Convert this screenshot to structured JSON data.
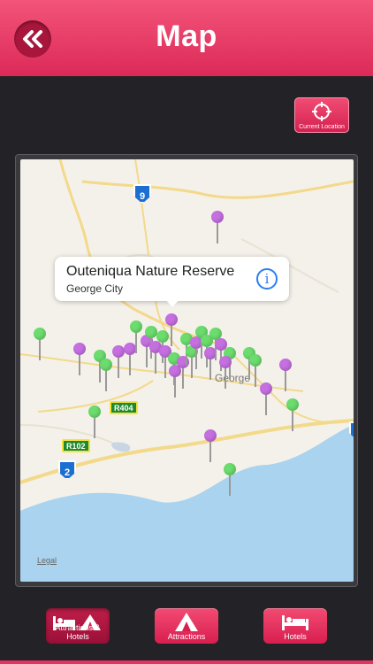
{
  "header": {
    "title": "Map",
    "back_icon": "double-chevron-left-icon"
  },
  "current_location": {
    "label": "Current Location",
    "icon": "crosshair-icon"
  },
  "map": {
    "callout": {
      "title": "Outeniqua Nature Reserve",
      "subtitle": "George City",
      "icon": "info-icon"
    },
    "place_label": "George",
    "legal": "Legal",
    "routes": {
      "n9": "9",
      "n2": "2",
      "r404": "R404",
      "r102": "R102"
    },
    "pin_colors": {
      "attraction": "#c56fe1",
      "hotel": "#6bdc6d"
    }
  },
  "tabs": [
    {
      "label": "Attractions & Hotels",
      "icon": "bed-and-tent-icon",
      "active": true
    },
    {
      "label": "Attractions",
      "icon": "tent-icon",
      "active": false
    },
    {
      "label": "Hotels",
      "icon": "bed-icon",
      "active": false
    }
  ],
  "colors": {
    "brand": "#e2325f",
    "background": "#232327"
  }
}
